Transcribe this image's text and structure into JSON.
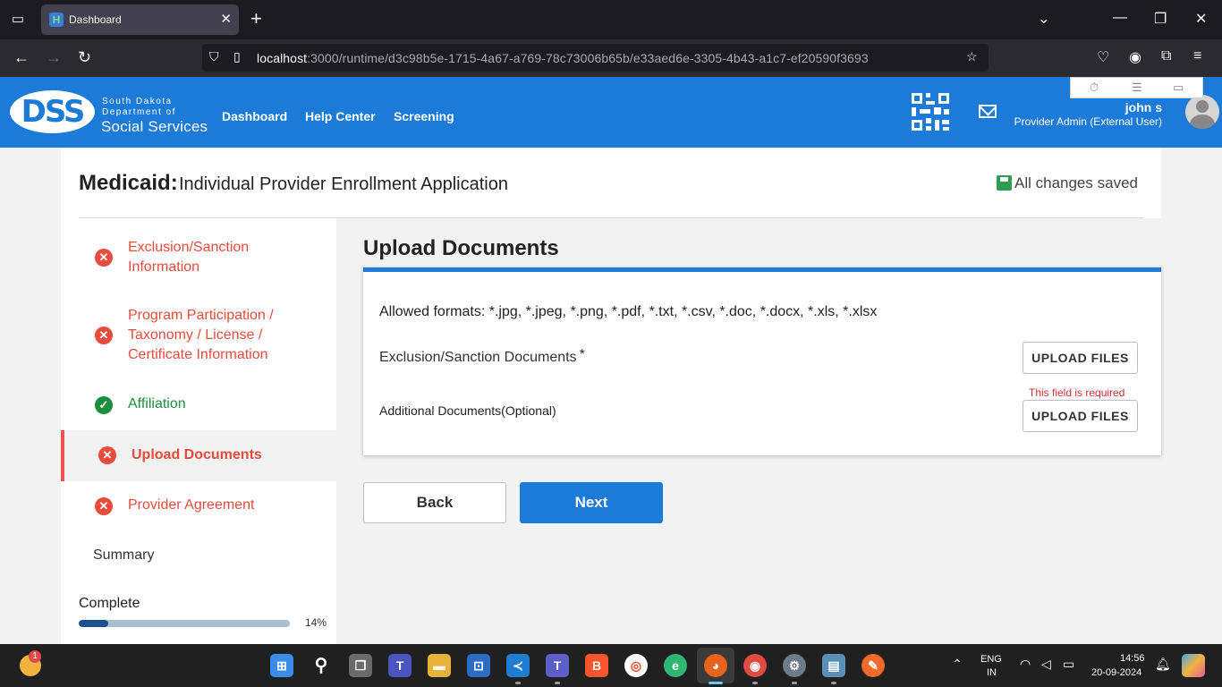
{
  "browser": {
    "tab_title": "Dashboard",
    "url_host": "localhost",
    "url_path": ":3000/runtime/d3c98b5e-1715-4a67-a769-78c73006b65b/e33aed6e-3305-4b43-a1c7-ef20590f3693"
  },
  "header": {
    "logo_text": "DSS",
    "logo_line1": "South Dakota",
    "logo_line2": "Department of",
    "logo_line3": "Social Services",
    "nav": [
      "Dashboard",
      "Help Center",
      "Screening"
    ],
    "user_name": "john s",
    "user_role": "Provider Admin (External User)"
  },
  "page": {
    "program": "Medicaid:",
    "title": "Individual Provider Enrollment Application",
    "save_status": "All changes saved"
  },
  "sidebar": {
    "items": [
      {
        "label_line1": "Exclusion/Sanction",
        "label_line2": "Information",
        "status": "error"
      },
      {
        "label_line1": "Program Participation /",
        "label_line2": "Taxonomy / License /",
        "label_line3": "Certificate Information",
        "status": "error"
      },
      {
        "label_line1": "Affiliation",
        "status": "complete"
      },
      {
        "label_line1": "Upload Documents",
        "status": "error",
        "active": true
      },
      {
        "label_line1": "Provider Agreement",
        "status": "error"
      },
      {
        "label_line1": "Summary",
        "status": "none"
      }
    ],
    "complete_label": "Complete",
    "progress_value": 0.14,
    "progress_text": "14%"
  },
  "main": {
    "section_title": "Upload Documents",
    "allowed_formats": "Allowed formats: *.jpg, *.jpeg, *.png, *.pdf, *.txt, *.csv, *.doc, *.docx, *.xls, *.xlsx",
    "doc1_label": "Exclusion/Sanction Documents",
    "doc1_required_mark": "*",
    "doc2_label": "Additional Documents(Optional)",
    "upload_label": "UPLOAD FILES",
    "required_message": "This field is required",
    "back_label": "Back",
    "next_label": "Next"
  },
  "taskbar": {
    "weather_badge": "1",
    "lang_line1": "ENG",
    "lang_line2": "IN",
    "time": "14:56",
    "date": "20-09-2024"
  },
  "colors": {
    "brand_blue": "#1c7bd8",
    "error_red": "#e74c3c",
    "success_green": "#1e8e3e"
  }
}
